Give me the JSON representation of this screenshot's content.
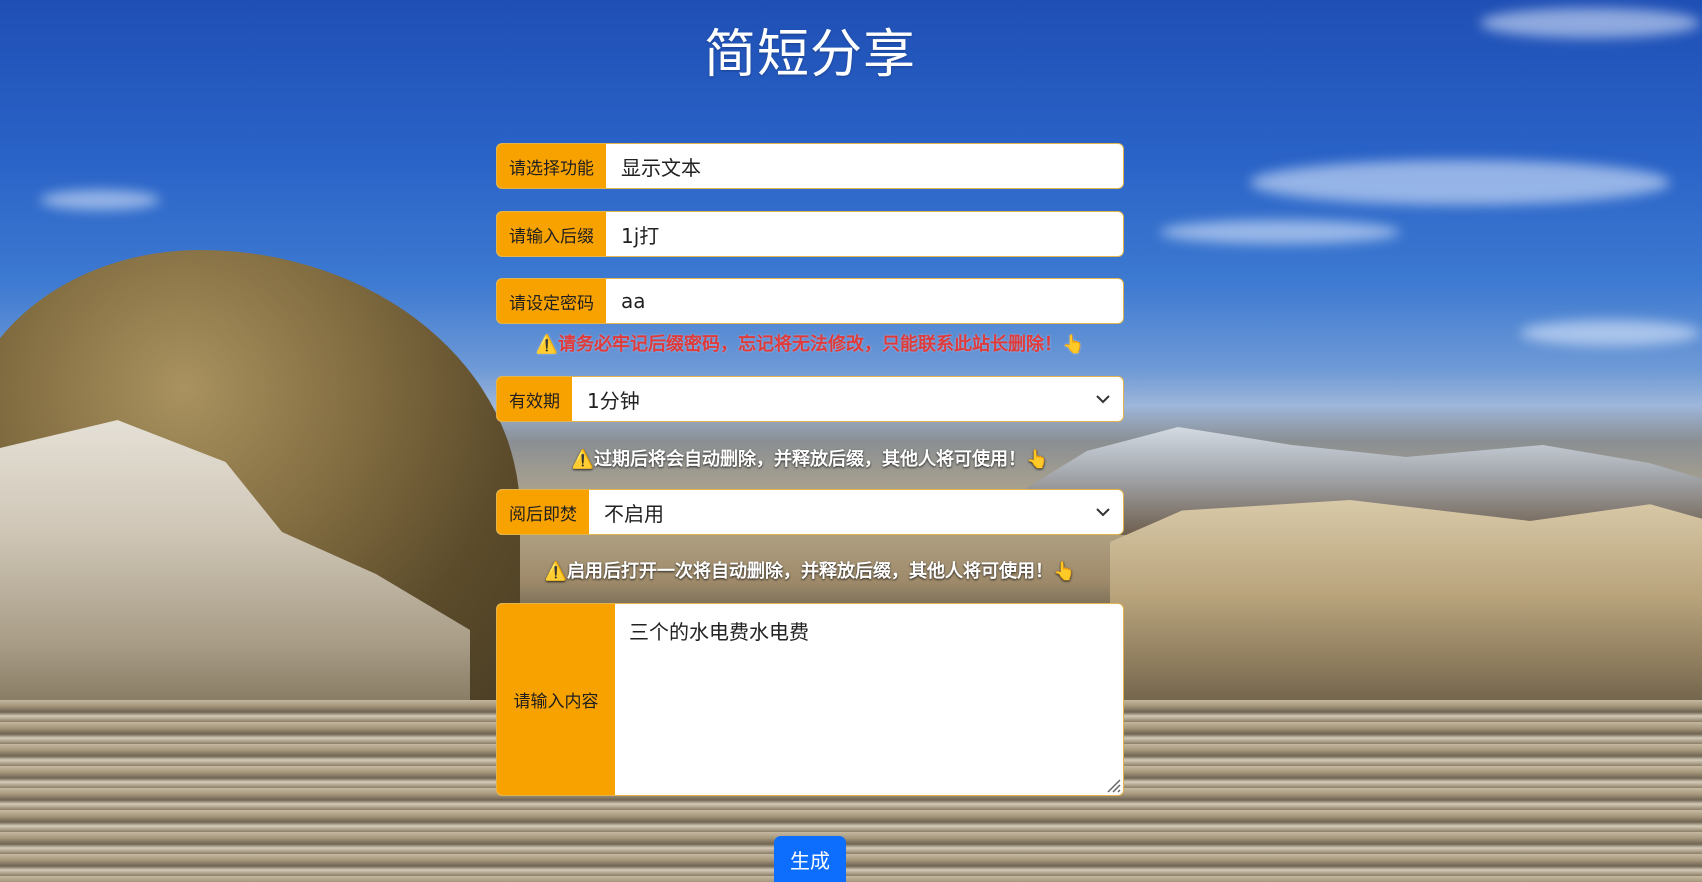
{
  "page": {
    "title": "简短分享"
  },
  "form": {
    "function": {
      "label": "请选择功能",
      "value": "显示文本"
    },
    "suffix": {
      "label": "请输入后缀",
      "value": "1j打"
    },
    "password": {
      "label": "请设定密码",
      "value": "aa"
    },
    "password_hint": "⚠️请务必牢记后缀密码，忘记将无法修改，只能联系此站长删除！👆",
    "expiry": {
      "label": "有效期",
      "value": "1分钟"
    },
    "expiry_hint": "⚠️过期后将会自动删除，并释放后缀，其他人将可使用！👆",
    "burn": {
      "label": "阅后即焚",
      "value": "不启用"
    },
    "burn_hint": "⚠️启用后打开一次将自动删除，并释放后缀，其他人将可使用！👆",
    "content": {
      "label": "请输入内容",
      "value": "三个的水电费水电费"
    },
    "submit_label": "生成"
  },
  "icons": {
    "dropdown": "chevron-down-icon",
    "resize": "resize-grip-icon"
  },
  "colors": {
    "label_bg": "#f8a200",
    "button_bg": "#0d6efd",
    "warning_red": "#e03b3b"
  }
}
